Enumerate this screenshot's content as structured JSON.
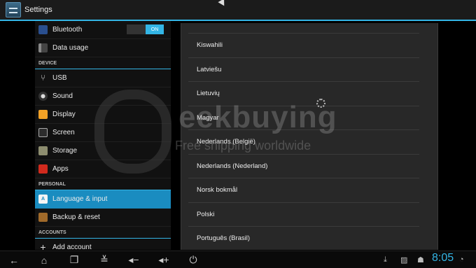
{
  "app": {
    "title": "Settings",
    "accent": "#33b5e5",
    "selected_color": "#1a8cc0"
  },
  "settings": {
    "bluetooth": {
      "label": "Bluetooth",
      "toggle": "ON"
    },
    "data_usage": "Data usage",
    "section_device": "DEVICE",
    "usb": "USB",
    "sound": "Sound",
    "display": "Display",
    "screen": "Screen",
    "storage": "Storage",
    "apps": "Apps",
    "section_personal": "PERSONAL",
    "language": "Language & input",
    "backup": "Backup & reset",
    "section_accounts": "ACCOUNTS",
    "add_account": "Add account"
  },
  "dialog": {
    "languages": [
      "Kiswahili",
      "Latviešu",
      "Lietuvių",
      "Magyar",
      "Nederlands (België)",
      "Nederlands (Nederland)",
      "Norsk bokmål",
      "Polski",
      "Português (Brasil)"
    ]
  },
  "watermark": {
    "brand": "eekbuying",
    "tagline": "Free shipping worldwide"
  },
  "status": {
    "time": "8:05"
  }
}
